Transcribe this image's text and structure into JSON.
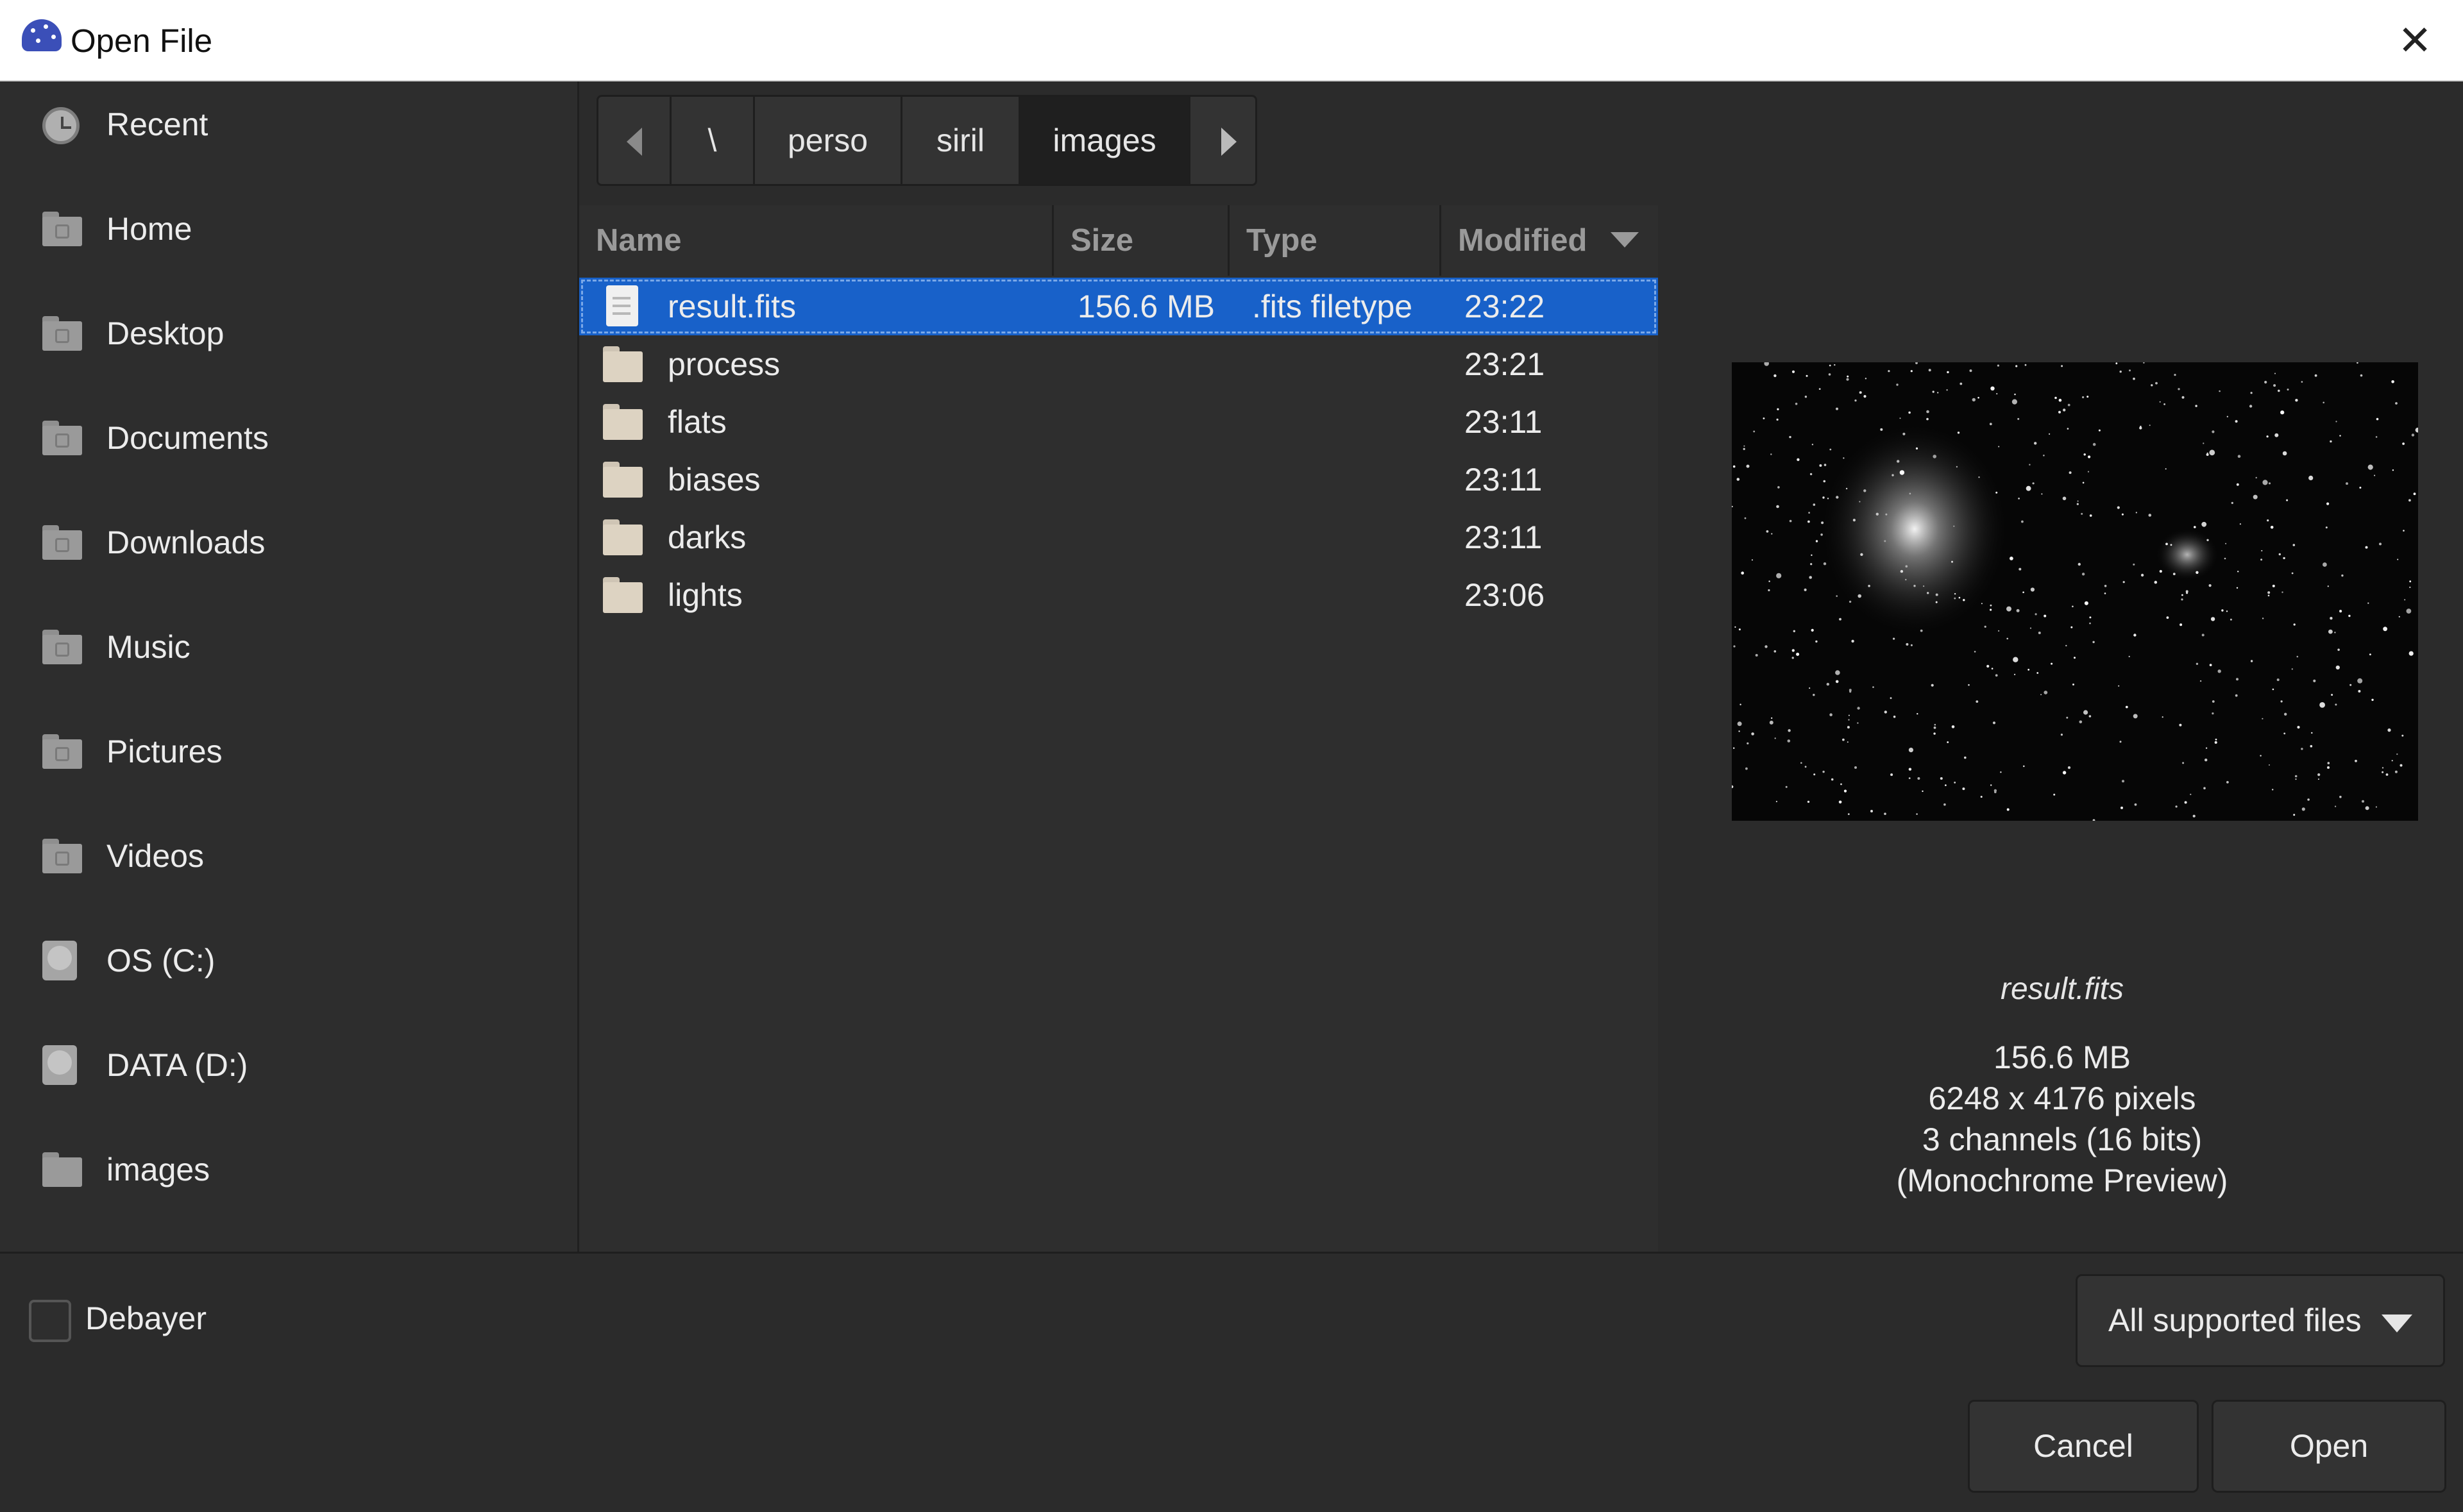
{
  "window": {
    "title": "Open File",
    "close_symbol": "✕"
  },
  "sidebar": {
    "items": [
      {
        "label": "Recent",
        "icon": "clock-icon"
      },
      {
        "label": "Home",
        "icon": "home-folder-icon"
      },
      {
        "label": "Desktop",
        "icon": "desktop-folder-icon"
      },
      {
        "label": "Documents",
        "icon": "documents-folder-icon"
      },
      {
        "label": "Downloads",
        "icon": "downloads-folder-icon"
      },
      {
        "label": "Music",
        "icon": "music-folder-icon"
      },
      {
        "label": "Pictures",
        "icon": "pictures-folder-icon"
      },
      {
        "label": "Videos",
        "icon": "videos-folder-icon"
      },
      {
        "label": "OS (C:)",
        "icon": "drive-icon"
      },
      {
        "label": "DATA (D:)",
        "icon": "drive-icon"
      },
      {
        "label": "images",
        "icon": "folder-icon"
      }
    ]
  },
  "pathbar": {
    "segments": [
      "\\",
      "perso",
      "siril",
      "images"
    ],
    "active": "images"
  },
  "filelist": {
    "columns": {
      "name": "Name",
      "size": "Size",
      "type": "Type",
      "modified": "Modified"
    },
    "sort_column": "Modified",
    "rows": [
      {
        "name": "result.fits",
        "size": "156.6 MB",
        "type": ".fits filetype",
        "modified": "23:22",
        "kind": "file",
        "selected": true
      },
      {
        "name": "process",
        "size": "",
        "type": "",
        "modified": "23:21",
        "kind": "folder"
      },
      {
        "name": "flats",
        "size": "",
        "type": "",
        "modified": "23:11",
        "kind": "folder"
      },
      {
        "name": "biases",
        "size": "",
        "type": "",
        "modified": "23:11",
        "kind": "folder"
      },
      {
        "name": "darks",
        "size": "",
        "type": "",
        "modified": "23:11",
        "kind": "folder"
      },
      {
        "name": "lights",
        "size": "",
        "type": "",
        "modified": "23:06",
        "kind": "folder"
      }
    ]
  },
  "preview": {
    "filename": "result.fits",
    "lines": [
      "156.6 MB",
      "6248 x 4176 pixels",
      "3 channels (16 bits)",
      "(Monochrome Preview)"
    ]
  },
  "bottom": {
    "debayer_label": "Debayer",
    "debayer_checked": false,
    "filter_value": "All supported files",
    "cancel_label": "Cancel",
    "open_label": "Open"
  },
  "colors": {
    "selection": "#1861c9",
    "background": "#2b2b2b"
  }
}
